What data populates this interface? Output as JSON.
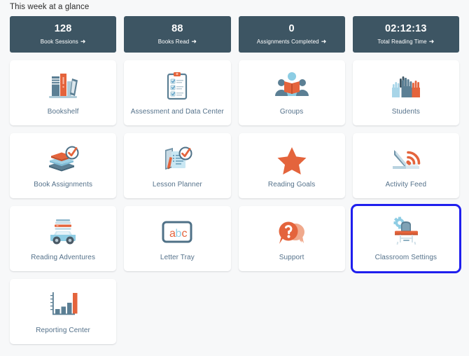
{
  "header": {
    "title": "This week at a glance"
  },
  "colors": {
    "page_background": "#f7f8f9",
    "stat_card": "#3d5563",
    "tile_label": "#54718a",
    "accent_orange": "#e4643c",
    "accent_slate": "#5b7f94",
    "accent_light_blue": "#a8d5e8",
    "focus_outline": "#1f1fee"
  },
  "stats": [
    {
      "value": "128",
      "label": "Book Sessions",
      "arrow": "➜",
      "icon": "arrow-right-icon"
    },
    {
      "value": "88",
      "label": "Books Read",
      "arrow": "➜",
      "icon": "arrow-right-icon"
    },
    {
      "value": "0",
      "label": "Assignments Completed",
      "arrow": "➜",
      "icon": "arrow-right-icon"
    },
    {
      "value": "02:12:13",
      "label": "Total Reading Time",
      "arrow": "➜",
      "icon": "arrow-right-icon"
    }
  ],
  "tiles": [
    {
      "label": "Bookshelf",
      "icon": "books-shelf-icon",
      "focused": false
    },
    {
      "label": "Assessment and Data Center",
      "icon": "clipboard-checklist-icon",
      "focused": false
    },
    {
      "label": "Groups",
      "icon": "group-reading-icon",
      "focused": false
    },
    {
      "label": "Students",
      "icon": "raised-hands-icon",
      "focused": false
    },
    {
      "label": "Book Assignments",
      "icon": "books-check-icon",
      "focused": false
    },
    {
      "label": "Lesson Planner",
      "icon": "notebook-pencil-check-icon",
      "focused": false
    },
    {
      "label": "Reading Goals",
      "icon": "star-icon",
      "focused": false
    },
    {
      "label": "Activity Feed",
      "icon": "book-rss-icon",
      "focused": false
    },
    {
      "label": "Reading Adventures",
      "icon": "book-car-icon",
      "focused": false
    },
    {
      "label": "Letter Tray",
      "icon": "abc-tray-icon",
      "focused": false
    },
    {
      "label": "Support",
      "icon": "question-chat-icon",
      "focused": false
    },
    {
      "label": "Classroom Settings",
      "icon": "desk-gear-icon",
      "focused": true
    },
    {
      "label": "Reporting Center",
      "icon": "bar-chart-icon",
      "focused": false
    }
  ]
}
